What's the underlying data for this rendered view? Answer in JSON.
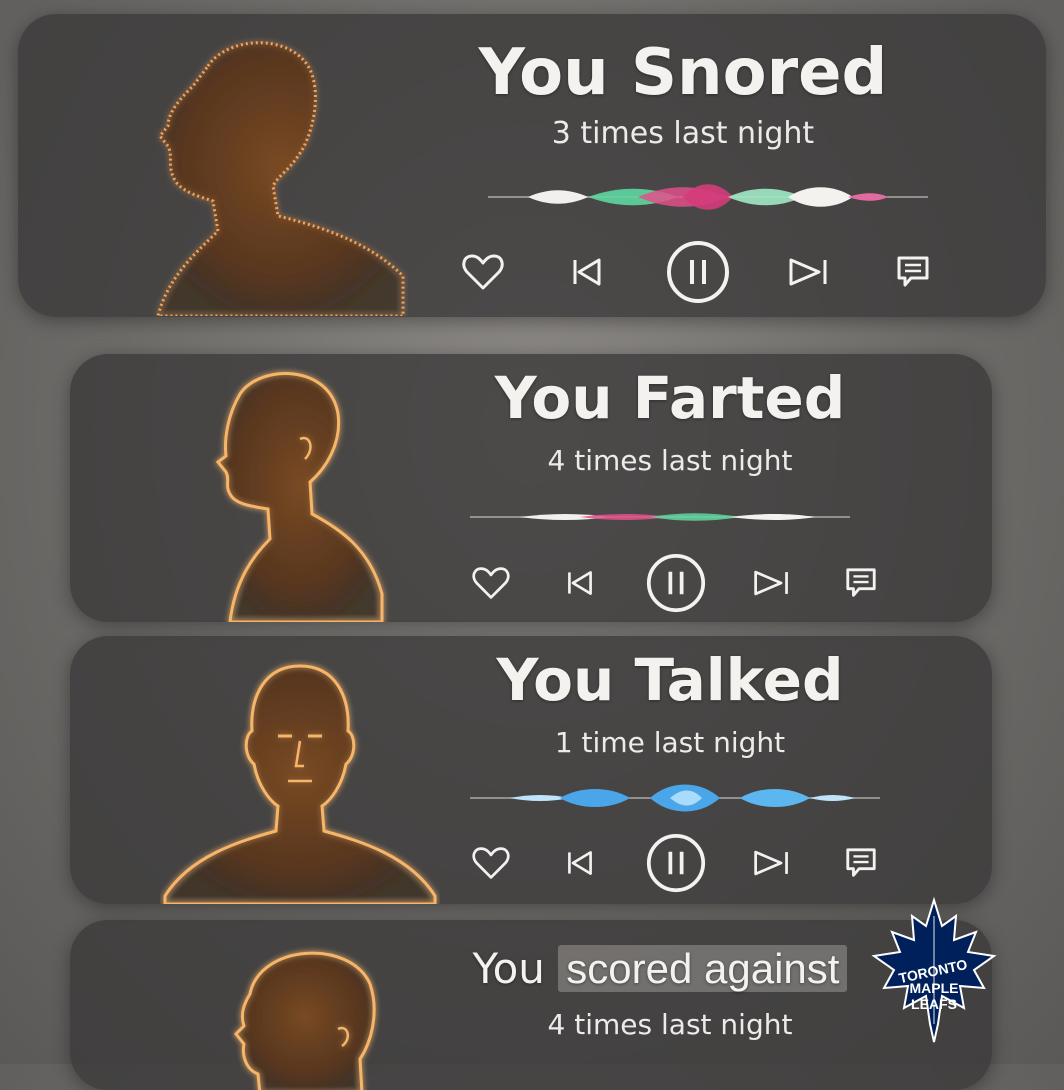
{
  "cards": [
    {
      "title": "You Snored",
      "subtitle": "3 times last night"
    },
    {
      "title": "You Farted",
      "subtitle": "4 times last night"
    },
    {
      "title": "You Talked",
      "subtitle": "1 time last night"
    },
    {
      "title_prefix": "You",
      "title_highlight": "scored against",
      "subtitle": "4 times last night"
    }
  ],
  "controls": [
    "heart-icon",
    "skip-back-icon",
    "pause-icon",
    "skip-forward-icon",
    "comment-icon"
  ],
  "logo": {
    "lines": [
      "TORONTO",
      "MAPLE",
      "LEAFS"
    ],
    "color": "#00205b"
  },
  "colors": {
    "card_bg": "#3a3938",
    "text": "#f4f2ef",
    "glow": "#f0a050",
    "wave_pink": "#e0508a",
    "wave_green": "#5fd6a0",
    "wave_blue": "#4aa6e8"
  }
}
